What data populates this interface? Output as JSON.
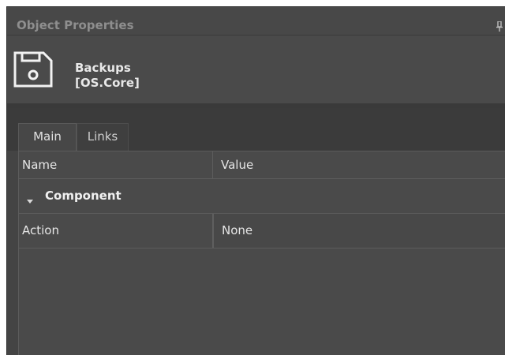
{
  "panel": {
    "title": "Object Properties",
    "pin_icon": "pin-icon"
  },
  "object": {
    "icon": "floppy-disk-icon",
    "name": "Backups",
    "id": "[OS.Core]"
  },
  "tabs": [
    {
      "label": "Main",
      "active": true
    },
    {
      "label": "Links",
      "active": false
    }
  ],
  "grid": {
    "columns": [
      "Name",
      "Value"
    ],
    "groups": [
      {
        "label": "Component",
        "expanded": true,
        "rows": [
          {
            "name": "Action",
            "value": "None"
          }
        ]
      }
    ]
  },
  "colors": {
    "panel_bg": "#444444",
    "text": "#e6e6e6",
    "title_text": "#8e8e8e"
  }
}
